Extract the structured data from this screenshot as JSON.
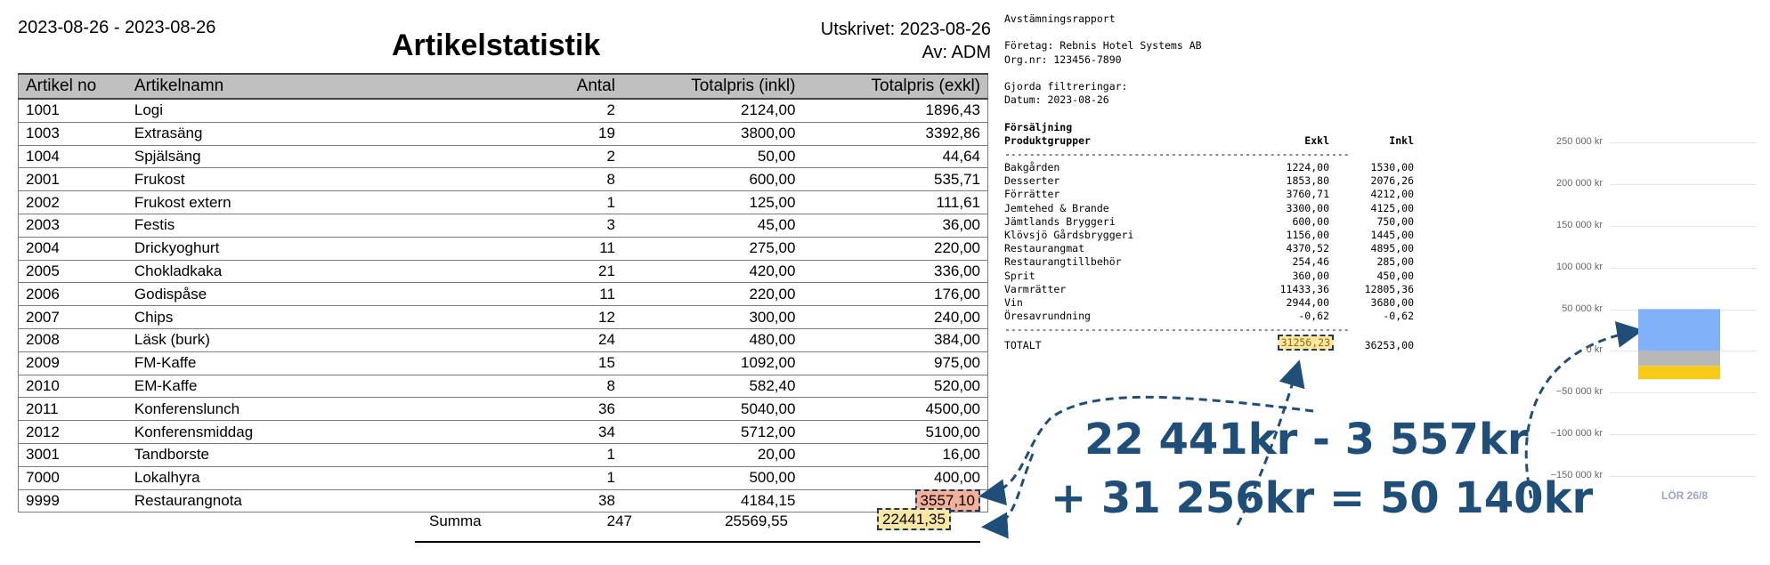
{
  "report": {
    "date_range": "2023-08-26 - 2023-08-26",
    "title": "Artikelstatistik",
    "printed": "Utskrivet: 2023-08-26",
    "by": "Av: ADM",
    "columns": [
      "Artikel no",
      "Artikelnamn",
      "Antal",
      "Totalpris (inkl)",
      "Totalpris (exkl)"
    ],
    "rows": [
      {
        "no": "1001",
        "name": "Logi",
        "antal": "2",
        "inkl": "2124,00",
        "exkl": "1896,43"
      },
      {
        "no": "1003",
        "name": "Extrasäng",
        "antal": "19",
        "inkl": "3800,00",
        "exkl": "3392,86"
      },
      {
        "no": "1004",
        "name": "Spjälsäng",
        "antal": "2",
        "inkl": "50,00",
        "exkl": "44,64"
      },
      {
        "no": "2001",
        "name": "Frukost",
        "antal": "8",
        "inkl": "600,00",
        "exkl": "535,71"
      },
      {
        "no": "2002",
        "name": "Frukost extern",
        "antal": "1",
        "inkl": "125,00",
        "exkl": "111,61"
      },
      {
        "no": "2003",
        "name": "Festis",
        "antal": "3",
        "inkl": "45,00",
        "exkl": "36,00"
      },
      {
        "no": "2004",
        "name": "Drickyoghurt",
        "antal": "11",
        "inkl": "275,00",
        "exkl": "220,00"
      },
      {
        "no": "2005",
        "name": "Chokladkaka",
        "antal": "21",
        "inkl": "420,00",
        "exkl": "336,00"
      },
      {
        "no": "2006",
        "name": "Godispåse",
        "antal": "11",
        "inkl": "220,00",
        "exkl": "176,00"
      },
      {
        "no": "2007",
        "name": "Chips",
        "antal": "12",
        "inkl": "300,00",
        "exkl": "240,00"
      },
      {
        "no": "2008",
        "name": "Läsk (burk)",
        "antal": "24",
        "inkl": "480,00",
        "exkl": "384,00"
      },
      {
        "no": "2009",
        "name": "FM-Kaffe",
        "antal": "15",
        "inkl": "1092,00",
        "exkl": "975,00"
      },
      {
        "no": "2010",
        "name": "EM-Kaffe",
        "antal": "8",
        "inkl": "582,40",
        "exkl": "520,00"
      },
      {
        "no": "2011",
        "name": "Konferenslunch",
        "antal": "36",
        "inkl": "5040,00",
        "exkl": "4500,00"
      },
      {
        "no": "2012",
        "name": "Konferensmiddag",
        "antal": "34",
        "inkl": "5712,00",
        "exkl": "5100,00"
      },
      {
        "no": "3001",
        "name": "Tandborste",
        "antal": "1",
        "inkl": "20,00",
        "exkl": "16,00"
      },
      {
        "no": "7000",
        "name": "Lokalhyra",
        "antal": "1",
        "inkl": "500,00",
        "exkl": "400,00"
      },
      {
        "no": "9999",
        "name": "Restaurangnota",
        "antal": "38",
        "inkl": "4184,15",
        "exkl": "3557,10",
        "highlight": "red"
      }
    ],
    "summa": {
      "label": "Summa",
      "antal": "247",
      "inkl": "25569,55",
      "exkl": "22441,35"
    }
  },
  "recon": {
    "title": "Avstämningsrapport",
    "company": "Företag: Rebnis Hotel Systems AB",
    "orgnr": "Org.nr: 123456-7890",
    "filters_heading": "Gjorda filtreringar:",
    "filters_date": "Datum: 2023-08-26",
    "section": "Försäljning",
    "group_heading": "Produktgrupper",
    "col_exkl": "Exkl",
    "col_inkl": "Inkl",
    "separator": "--------------------------------------------------------",
    "rows": [
      {
        "name": "Bakgården",
        "exkl": "1224,00",
        "inkl": "1530,00"
      },
      {
        "name": "Desserter",
        "exkl": "1853,80",
        "inkl": "2076,26"
      },
      {
        "name": "Förrätter",
        "exkl": "3760,71",
        "inkl": "4212,00"
      },
      {
        "name": "Jemtehed & Brande",
        "exkl": "3300,00",
        "inkl": "4125,00"
      },
      {
        "name": "Jämtlands Bryggeri",
        "exkl": "600,00",
        "inkl": "750,00"
      },
      {
        "name": "Klövsjö Gårdsbryggeri",
        "exkl": "1156,00",
        "inkl": "1445,00"
      },
      {
        "name": "Restaurangmat",
        "exkl": "4370,52",
        "inkl": "4895,00"
      },
      {
        "name": "Restaurangtillbehör",
        "exkl": "254,46",
        "inkl": "285,00"
      },
      {
        "name": "Sprit",
        "exkl": "360,00",
        "inkl": "450,00"
      },
      {
        "name": "Varmrätter",
        "exkl": "11433,36",
        "inkl": "12805,36"
      },
      {
        "name": "Vin",
        "exkl": "2944,00",
        "inkl": "3680,00"
      },
      {
        "name": "Öresavrundning",
        "exkl": "-0,62",
        "inkl": "-0,62"
      }
    ],
    "total": {
      "name": "TOTALT",
      "exkl": "31256,23",
      "inkl": "36253,00"
    }
  },
  "equation": {
    "line1": "22 441kr - 3 557kr",
    "line2": "+ 31 256kr = 50 140kr"
  },
  "colors": {
    "annotation": "#1f4e79",
    "bar_blue": "#7fb0f8",
    "bar_gray": "#b8b8b8",
    "bar_yellow": "#f7ca18"
  },
  "chart_data": {
    "type": "bar",
    "categories": [
      "LÖR 26/8"
    ],
    "ticks": [
      "250 000 kr",
      "200 000 kr",
      "150 000 kr",
      "100 000 kr",
      "50 000 kr",
      "0 kr",
      "−50 000 kr",
      "−100 000 kr",
      "−150 000 kr"
    ],
    "ylim": [
      -150000,
      250000
    ],
    "series": [
      {
        "color": "#7fb0f8",
        "values": [
          50140
        ]
      },
      {
        "color": "#b8b8b8",
        "values": [
          -18000
        ]
      },
      {
        "color": "#f7ca18",
        "values": [
          -16000
        ]
      }
    ]
  }
}
